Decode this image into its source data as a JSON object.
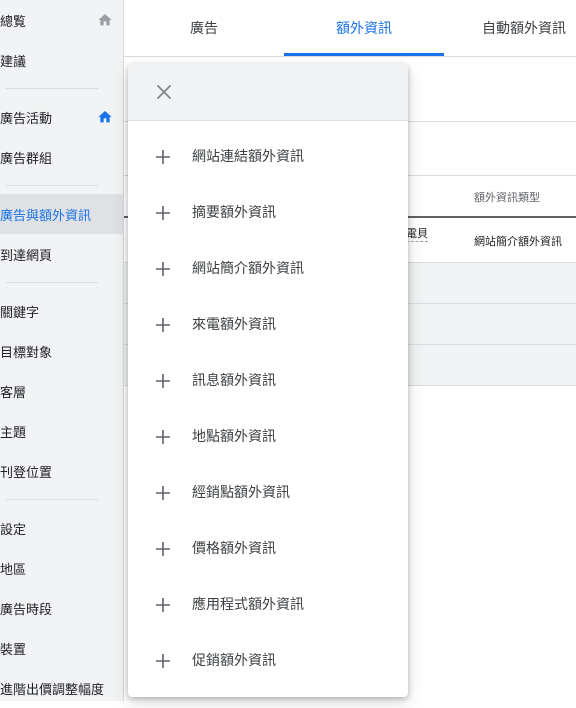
{
  "sidebar": {
    "items": [
      {
        "label": "總覧",
        "home_icon": "home-icon"
      },
      {
        "label": "建議"
      },
      {
        "label": "廣告活動",
        "home_icon": "home-icon"
      },
      {
        "label": "廣告群組"
      },
      {
        "label": "廣告與額外資訊",
        "active": true
      },
      {
        "label": "到達網頁"
      },
      {
        "label": "關鍵字"
      },
      {
        "label": "目標對象"
      },
      {
        "label": "客層"
      },
      {
        "label": "主題"
      },
      {
        "label": "刊登位置"
      },
      {
        "label": "設定"
      },
      {
        "label": "地區"
      },
      {
        "label": "廣告時段"
      },
      {
        "label": "裝置"
      },
      {
        "label": "進階出價調整幅度"
      }
    ]
  },
  "tabs": [
    {
      "label": "廣告"
    },
    {
      "label": "額外資訊",
      "active": true
    },
    {
      "label": "自動額外資訊"
    }
  ],
  "table": {
    "column_header": "額外資訊類型",
    "partial_cell": "電貝",
    "row_value": "網站簡介額外資訊"
  },
  "menu": {
    "close_icon": "close-icon",
    "items": [
      {
        "label": "網站連結額外資訊"
      },
      {
        "label": "摘要額外資訊"
      },
      {
        "label": "網站簡介額外資訊"
      },
      {
        "label": "來電額外資訊"
      },
      {
        "label": "訊息額外資訊"
      },
      {
        "label": "地點額外資訊"
      },
      {
        "label": "經銷點額外資訊"
      },
      {
        "label": "價格額外資訊"
      },
      {
        "label": "應用程式額外資訊"
      },
      {
        "label": "促銷額外資訊"
      }
    ]
  },
  "colors": {
    "accent": "#1a73e8",
    "sidebar_bg": "#f1f3f4",
    "active_bg": "#dfe1e5",
    "text": "#202124"
  }
}
